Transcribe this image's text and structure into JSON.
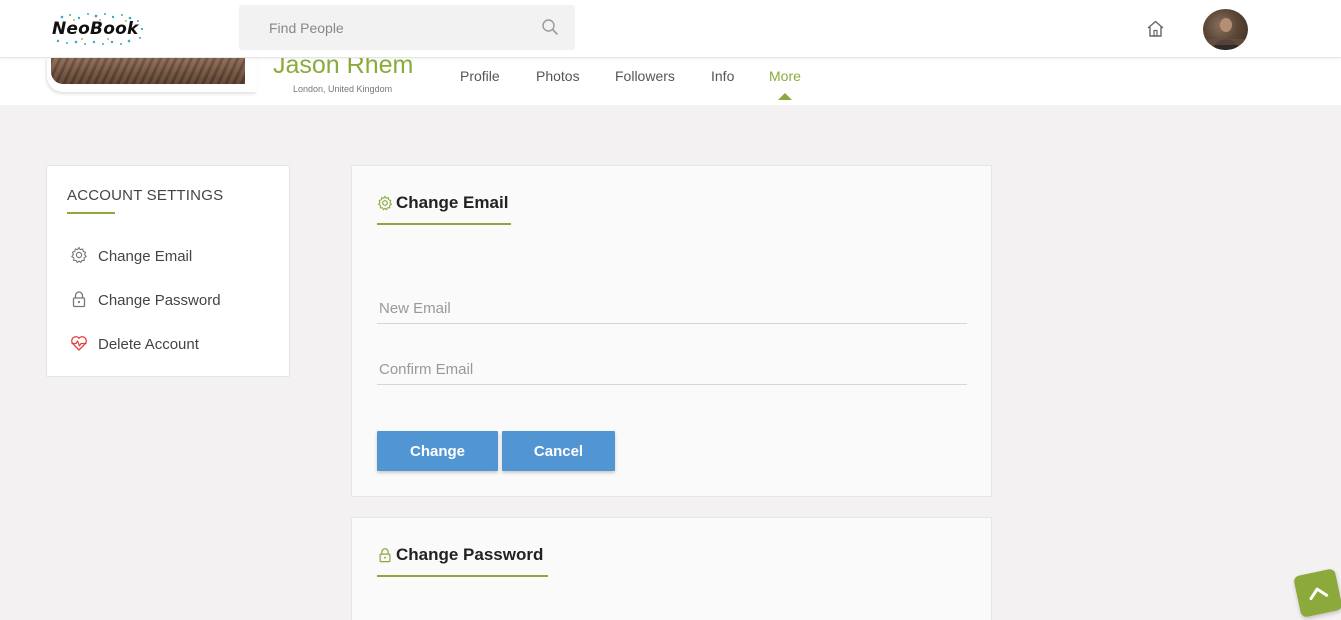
{
  "brand": {
    "logo_text": "NeoBook",
    "accent": "#8caa3b",
    "button_color": "#5295d3"
  },
  "search": {
    "placeholder": "Find People",
    "icon": "search-icon"
  },
  "header_icons": {
    "home": "home-icon",
    "avatar": "user-avatar"
  },
  "profile": {
    "name": "Jason Rhem",
    "location": "London, United Kingdom",
    "tabs": [
      {
        "label": "Profile",
        "active": false
      },
      {
        "label": "Photos",
        "active": false
      },
      {
        "label": "Followers",
        "active": false
      },
      {
        "label": "Info",
        "active": false
      },
      {
        "label": "More",
        "active": true
      }
    ]
  },
  "sidebar": {
    "title": "ACCOUNT SETTINGS",
    "items": [
      {
        "label": "Change Email",
        "icon": "gear-icon"
      },
      {
        "label": "Change Password",
        "icon": "lock-icon"
      },
      {
        "label": "Delete Account",
        "icon": "heart-pulse-icon"
      }
    ]
  },
  "change_email": {
    "title": "Change Email",
    "icon": "gear-icon",
    "new_email_placeholder": "New Email",
    "confirm_email_placeholder": "Confirm Email",
    "change_label": "Change",
    "cancel_label": "Cancel"
  },
  "change_password": {
    "title": "Change Password",
    "icon": "lock-icon"
  }
}
